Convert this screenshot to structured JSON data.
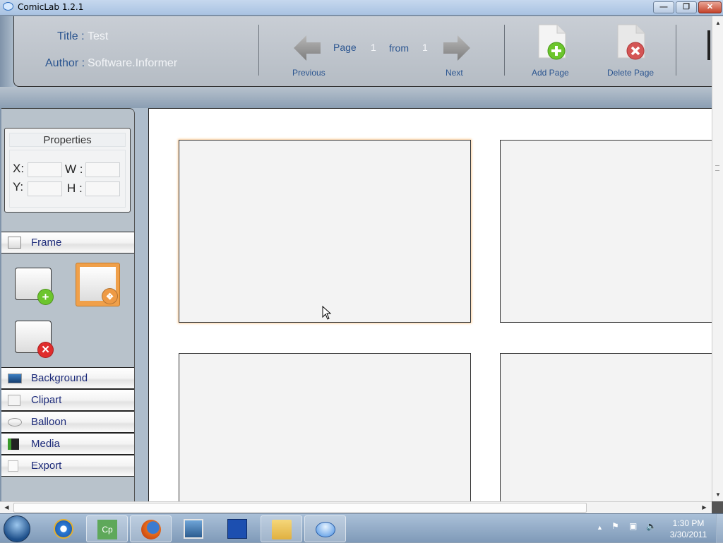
{
  "window": {
    "title": "ComicLab 1.2.1",
    "controls": {
      "minimize": "—",
      "maximize": "❐",
      "close": "✕"
    }
  },
  "header": {
    "title_label": "Title :",
    "title_value": "Test",
    "author_label": "Author :",
    "author_value": "Software.Informer"
  },
  "pagination": {
    "page_word": "Page",
    "current_page": "1",
    "from_word": "from",
    "total_pages": "1",
    "previous_label": "Previous",
    "next_label": "Next"
  },
  "toolbar": {
    "add_page_label": "Add Page",
    "delete_page_label": "Delete Page"
  },
  "properties": {
    "header": "Properties",
    "x_label": "X:",
    "y_label": "Y:",
    "w_label": "W :",
    "h_label": "H :",
    "x_value": "",
    "y_value": "",
    "w_value": "",
    "h_value": ""
  },
  "sidebar": {
    "frame_section": {
      "label": "Frame",
      "icon": "frame-icon"
    },
    "frame_tools": [
      {
        "name": "add-frame",
        "icon": "add-frame-icon"
      },
      {
        "name": "move-frame",
        "icon": "move-frame-icon",
        "selected": true
      },
      {
        "name": "delete-frame",
        "icon": "delete-frame-icon"
      }
    ],
    "sections": [
      {
        "label": "Background",
        "icon": "background-icon"
      },
      {
        "label": "Clipart",
        "icon": "clipart-icon"
      },
      {
        "label": "Balloon",
        "icon": "balloon-icon"
      },
      {
        "label": "Media",
        "icon": "media-icon"
      },
      {
        "label": "Export",
        "icon": "export-icon"
      }
    ]
  },
  "canvas": {
    "panels": [
      {
        "id": "panel-1",
        "selected": true
      },
      {
        "id": "panel-2",
        "selected": false
      },
      {
        "id": "panel-3",
        "selected": false
      },
      {
        "id": "panel-4",
        "selected": false
      }
    ]
  },
  "taskbar": {
    "apps": [
      {
        "name": "internet-explorer",
        "active": false
      },
      {
        "name": "comiclab-setup",
        "active": true
      },
      {
        "name": "firefox",
        "active": true
      },
      {
        "name": "photo-gallery",
        "active": false
      },
      {
        "name": "save-disk",
        "active": false
      },
      {
        "name": "windows-explorer",
        "active": true
      },
      {
        "name": "comiclab",
        "active": true
      }
    ],
    "clock_time": "1:30 PM",
    "clock_date": "3/30/2011",
    "tray_expand": "▲"
  },
  "colors": {
    "accent_text": "#2b5590",
    "section_text": "#1d2b7a",
    "selection_glow": "#ffcf9a"
  }
}
